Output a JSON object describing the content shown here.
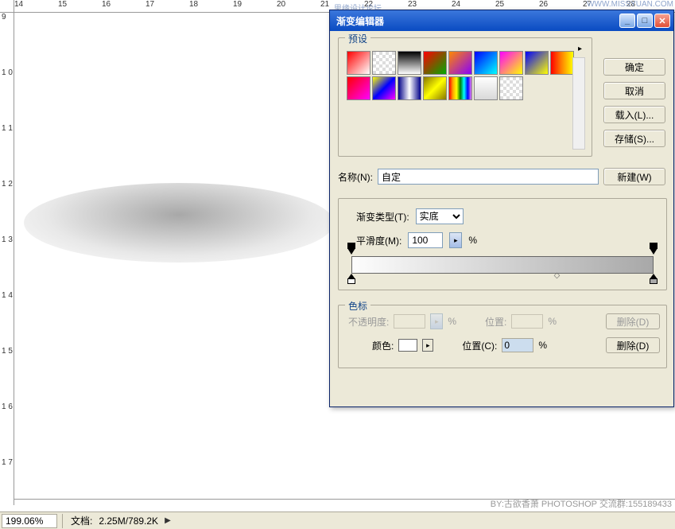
{
  "ruler_h": [
    "14",
    "15",
    "16",
    "17",
    "18",
    "19",
    "20",
    "21",
    "22",
    "23",
    "24",
    "25",
    "26",
    "27",
    "28"
  ],
  "ruler_v": [
    "9",
    "1\n0",
    "1\n1",
    "1\n2",
    "1\n3",
    "1\n4",
    "1\n5",
    "1\n6",
    "1\n7"
  ],
  "status": {
    "zoom": "199.06%",
    "doc_label": "文档:",
    "doc_value": "2.25M/789.2K"
  },
  "dialog": {
    "title": "渐变编辑器",
    "presets_legend": "预设",
    "preset_menu": "▸",
    "buttons": {
      "ok": "确定",
      "cancel": "取消",
      "load": "载入(L)...",
      "save": "存储(S)...",
      "new": "新建(W)"
    },
    "name_label": "名称(N):",
    "name_value": "自定",
    "gtype_label": "渐变类型(T):",
    "gtype_value": "实底",
    "smooth_label": "平滑度(M):",
    "smooth_value": "100",
    "smooth_unit": "%",
    "stops_legend": "色标",
    "opacity_row": {
      "label": "不透明度:",
      "unit": "%",
      "pos_label": "位置:",
      "pos_unit": "%",
      "delete": "删除(D)"
    },
    "color_row": {
      "label": "颜色:",
      "pos_label": "位置(C):",
      "pos_value": "0",
      "pos_unit": "%",
      "delete": "删除(D)"
    }
  },
  "preset_gradients": [
    "linear-gradient(135deg,#f00,#fff)",
    "repeating-conic-gradient(#fff 0 25%,#ddd 0 50%) 0 0/8px 8px",
    "linear-gradient(to bottom,#000,#fff)",
    "linear-gradient(135deg,#f00,#0a0)",
    "linear-gradient(135deg,#f80,#80f)",
    "linear-gradient(135deg,#00f,#0ff)",
    "linear-gradient(135deg,#f0f,#ff0)",
    "linear-gradient(135deg,#00f,#ff0)",
    "linear-gradient(to right,#f00,#f80,#ff0)",
    "linear-gradient(135deg,#f00,#f0f)",
    "linear-gradient(135deg,#ff0,#00f,#f0f)",
    "linear-gradient(to right,#008,#fff,#008)",
    "linear-gradient(135deg,#870,#ff0,#870)",
    "linear-gradient(to right,red,orange,yellow,green,cyan,blue,violet)",
    "linear-gradient(to bottom,#fff,#d8d8d8)",
    "repeating-conic-gradient(#fff 0 25%,#ddd 0 50%) 0 0/8px 8px"
  ],
  "watermark": {
    "right": "WWW.MISSYUAN.COM",
    "left": "思缘设计论坛"
  },
  "footer": "BY:古欲香萧  PHOTOSHOP 交流群:155189433"
}
